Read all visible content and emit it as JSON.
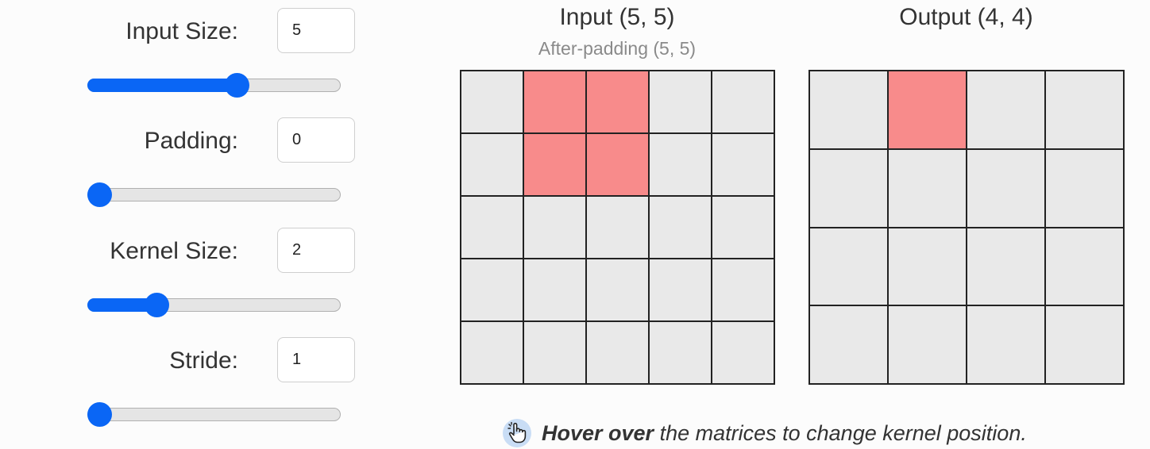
{
  "controls": [
    {
      "id": "input-size",
      "label": "Input Size:",
      "value": "5",
      "slider_fraction": 0.6
    },
    {
      "id": "padding",
      "label": "Padding:",
      "value": "0",
      "slider_fraction": 0.0
    },
    {
      "id": "kernel-size",
      "label": "Kernel Size:",
      "value": "2",
      "slider_fraction": 0.25
    },
    {
      "id": "stride",
      "label": "Stride:",
      "value": "1",
      "slider_fraction": 0.0
    }
  ],
  "input_matrix": {
    "title": "Input (5, 5)",
    "subtitle": "After-padding (5, 5)",
    "rows": 5,
    "cols": 5,
    "highlight": [
      [
        0,
        1
      ],
      [
        0,
        2
      ],
      [
        1,
        1
      ],
      [
        1,
        2
      ]
    ]
  },
  "output_matrix": {
    "title": "Output (4, 4)",
    "rows": 4,
    "cols": 4,
    "highlight": [
      [
        0,
        1
      ]
    ]
  },
  "hint": {
    "icon": "pointer-hand-icon",
    "bold_text": "Hover over",
    "text": " the matrices to change kernel position."
  },
  "colors": {
    "accent": "#0a66f5",
    "cell": "#e9e9e9",
    "highlight": "#f88b8b",
    "grid_line": "#222222"
  }
}
